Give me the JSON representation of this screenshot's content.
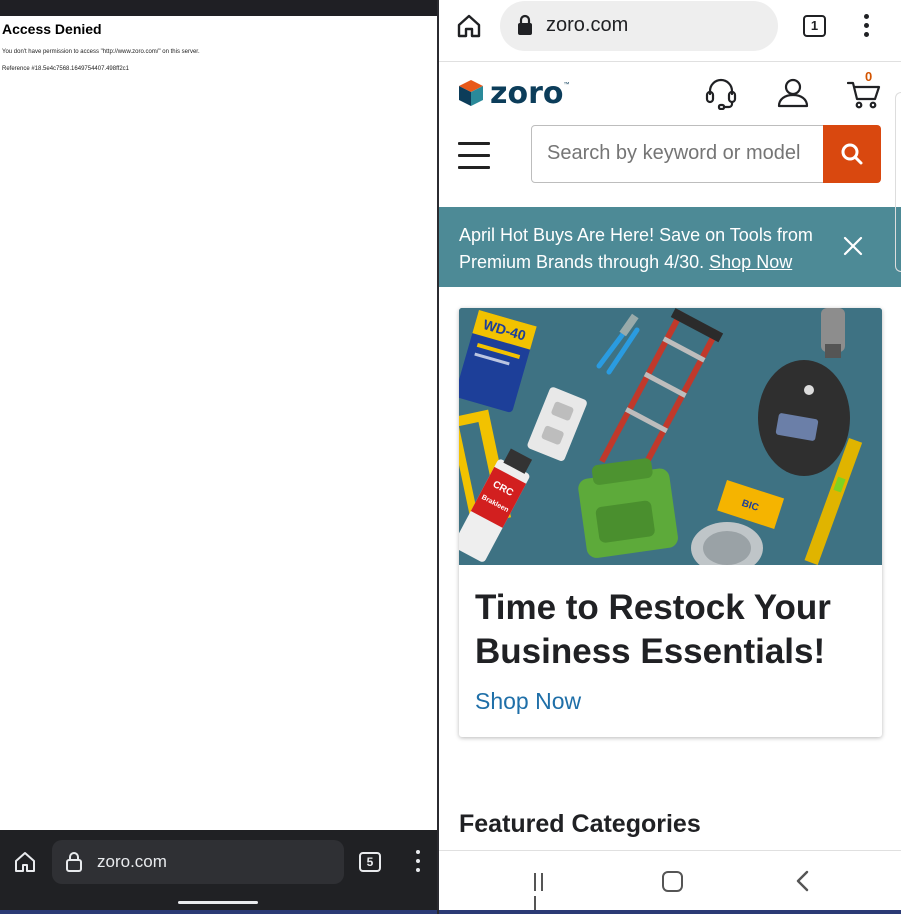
{
  "left_pane": {
    "error_title": "Access Denied",
    "error_message": "You don't have permission to access \"http://www.zoro.com/\" on this server.",
    "reference": "Reference #18.5e4c7568.1649754407.498ff2c1",
    "toolbar": {
      "url": "zoro.com",
      "tab_count": "5",
      "icons": [
        "home-icon",
        "lock-icon",
        "tab-switcher-icon",
        "more-menu-icon"
      ]
    }
  },
  "right_pane": {
    "browser": {
      "url": "zoro.com",
      "tab_count": "1",
      "icons": [
        "home-icon",
        "lock-icon",
        "tab-switcher-icon",
        "more-menu-icon"
      ]
    },
    "header": {
      "logo_text": "zoro",
      "logo_tm": "™",
      "cart_count": "0",
      "icons": [
        "headset-icon",
        "user-icon",
        "cart-icon"
      ],
      "search_placeholder": "Search by keyword or model"
    },
    "promo": {
      "text": "April Hot Buys Are Here! Save on Tools from Premium Brands through 4/30.",
      "link": "Shop Now",
      "color": "#4d8a96"
    },
    "hero": {
      "title": "Time to Restock Your Business Essentials!",
      "link": "Shop Now",
      "image_labels": [
        "WD-40",
        "CRC",
        "Brakleen",
        "BIC"
      ]
    },
    "featured_heading": "Featured Categories",
    "nav_bar": [
      "recent-apps-icon",
      "home-icon",
      "back-icon"
    ]
  },
  "colors": {
    "accent_orange": "#d9480f",
    "brand_navy": "#0c3d5a",
    "link_blue": "#1f6fa8",
    "hero_bg": "#3e7283"
  }
}
